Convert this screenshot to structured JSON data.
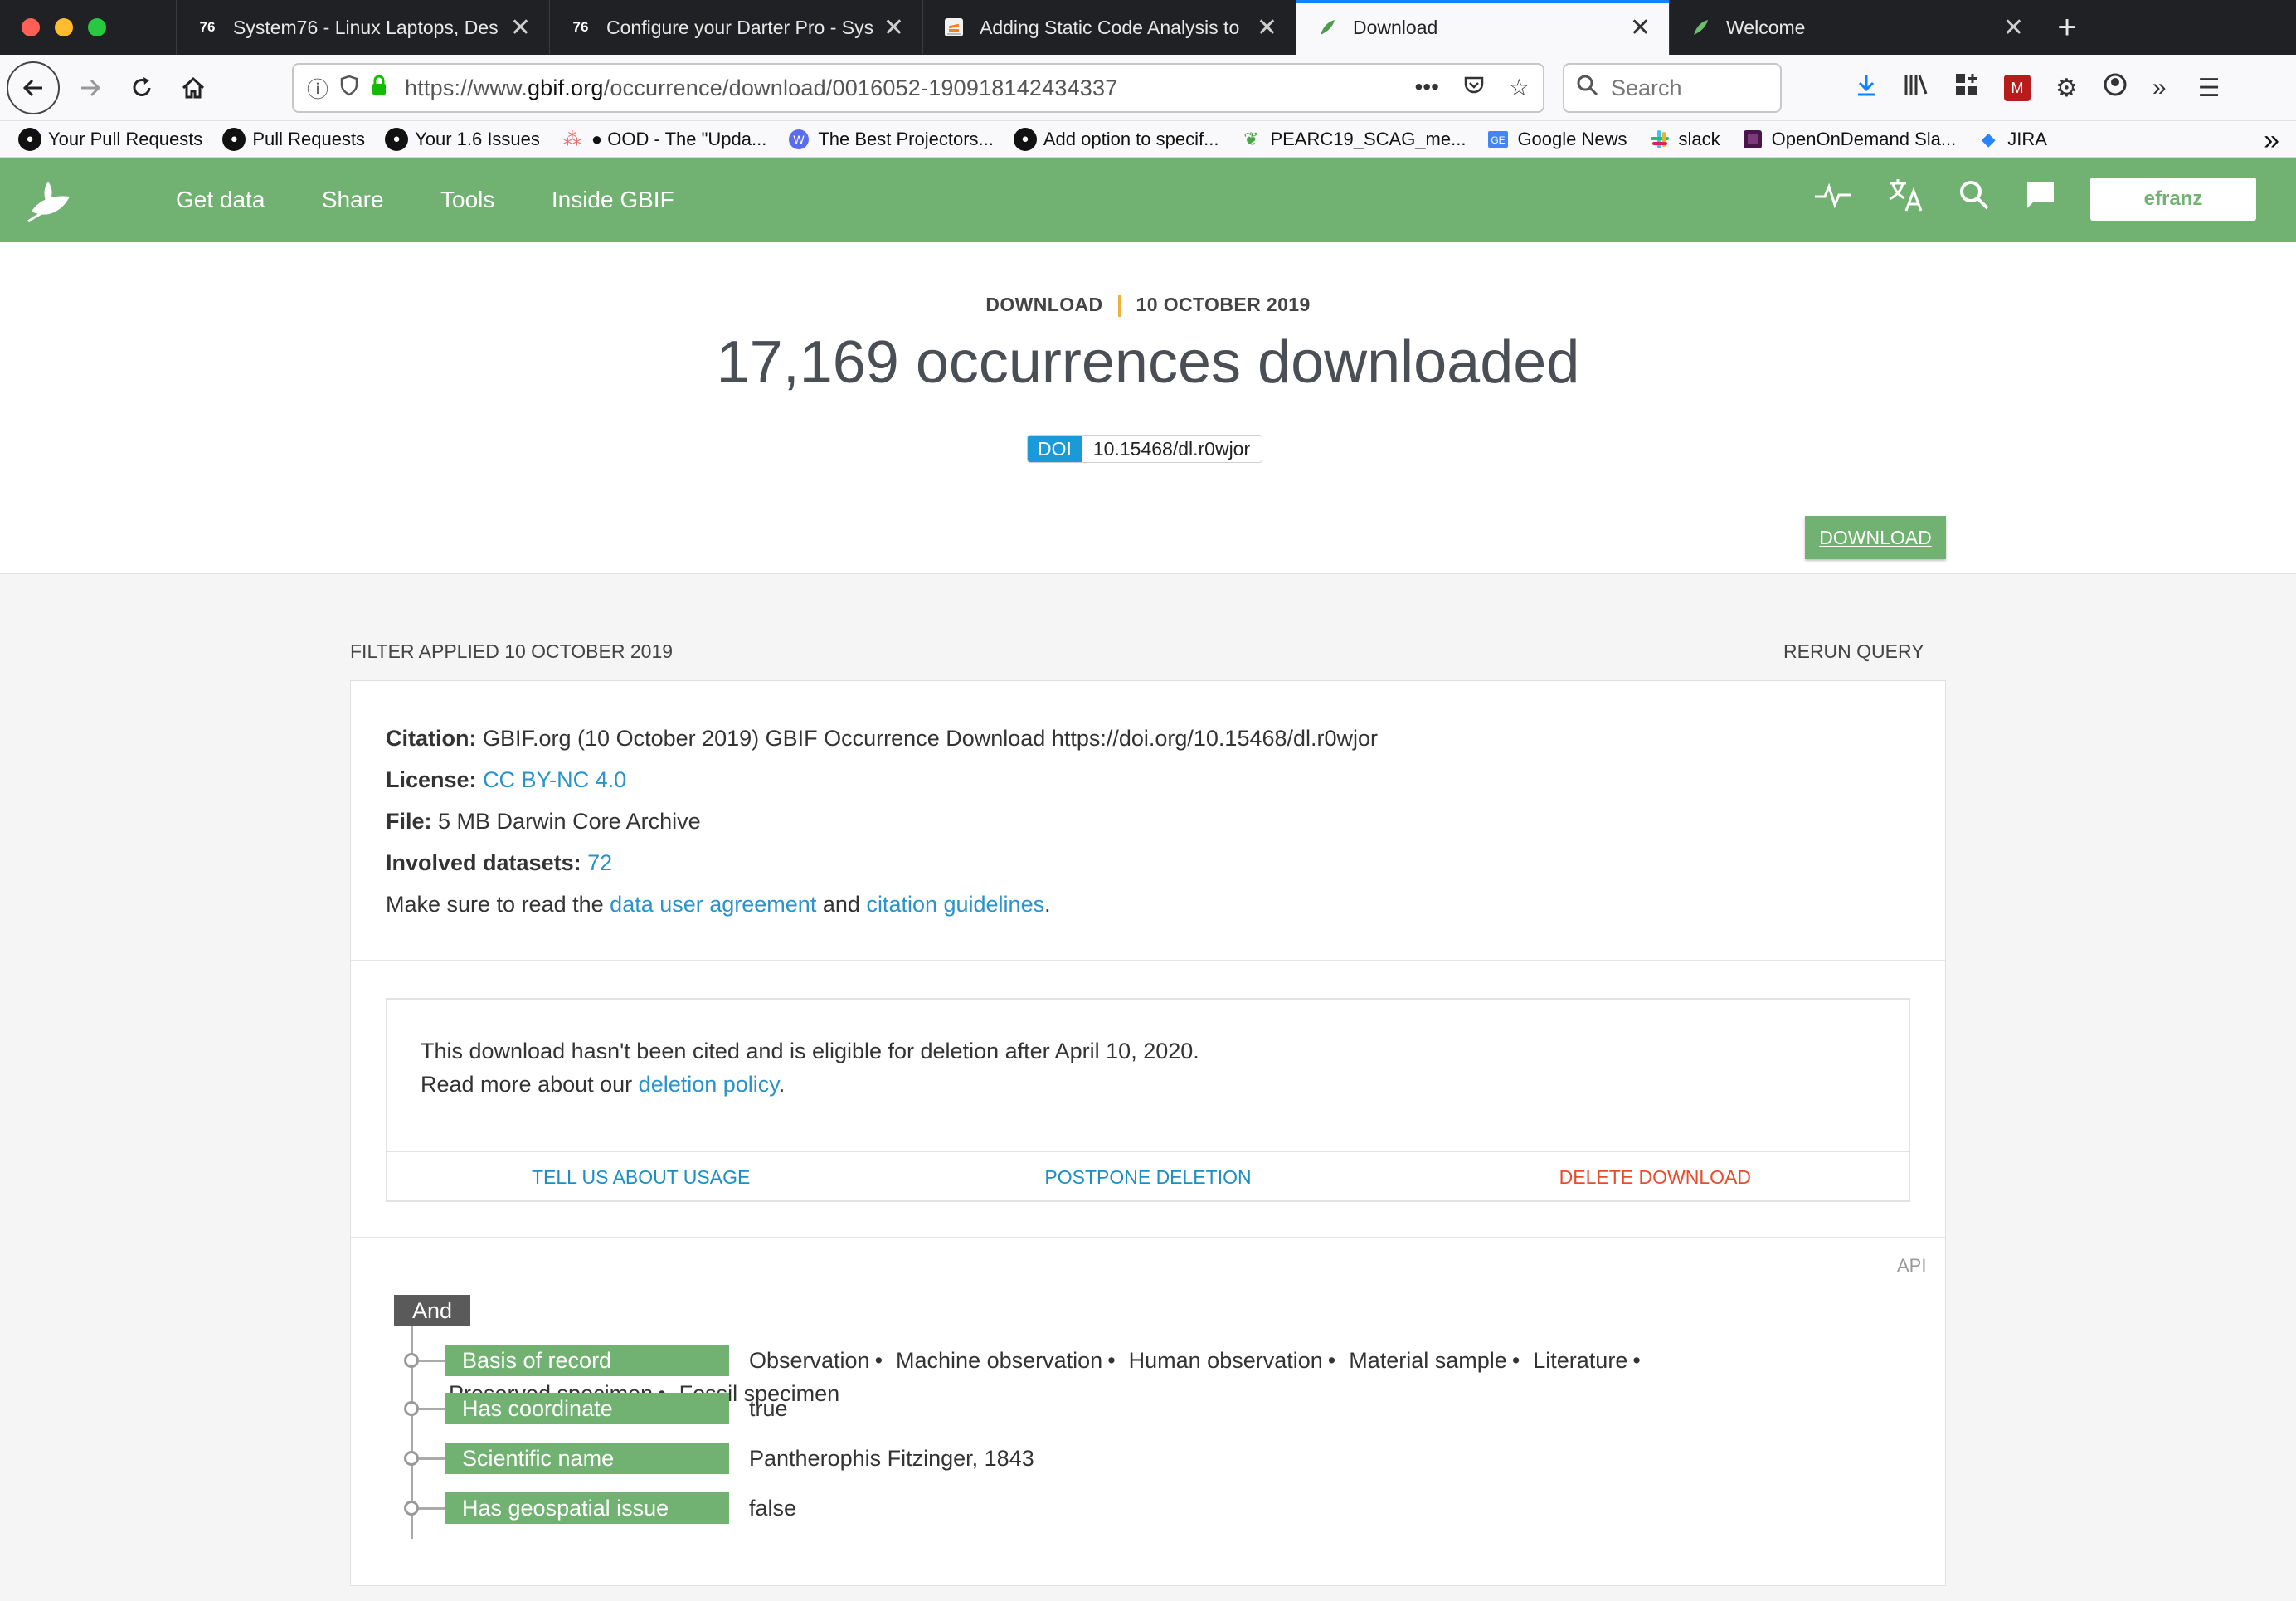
{
  "browser": {
    "tabs": [
      {
        "title": "System76 - Linux Laptops, Des",
        "favicon": "system76-icon",
        "active": false
      },
      {
        "title": "Configure your Darter Pro - Sys",
        "favicon": "system76-icon",
        "active": false
      },
      {
        "title": "Adding Static Code Analysis to",
        "favicon": "stackoverflow-icon",
        "active": false
      },
      {
        "title": "Download",
        "favicon": "gbif-icon",
        "active": true
      },
      {
        "title": "Welcome",
        "favicon": "gbif-icon",
        "active": false
      }
    ],
    "url_prefix": "https://www.",
    "url_domain": "gbif.org",
    "url_path": "/occurrence/download/0016052-190918142434337",
    "search_placeholder": "Search",
    "bookmarks": [
      {
        "label": "Your Pull Requests",
        "icon": "github-icon"
      },
      {
        "label": "Pull Requests",
        "icon": "github-icon"
      },
      {
        "label": "Your 1.6 Issues",
        "icon": "github-icon"
      },
      {
        "label": "● OOD - The \"Upda...",
        "icon": "asana-icon"
      },
      {
        "label": "The Best Projectors...",
        "icon": "wirecutter-icon"
      },
      {
        "label": "Add option to specif...",
        "icon": "github-icon"
      },
      {
        "label": "PEARC19_SCAG_me...",
        "icon": "leaf-icon"
      },
      {
        "label": "Google News",
        "icon": "google-news-icon"
      },
      {
        "label": "slack",
        "icon": "slack-icon"
      },
      {
        "label": "OpenOnDemand Sla...",
        "icon": "slack-workspace-icon"
      },
      {
        "label": "JIRA",
        "icon": "jira-icon"
      }
    ]
  },
  "gbif": {
    "menu": [
      "Get data",
      "Share",
      "Tools",
      "Inside GBIF"
    ],
    "user": "efranz",
    "accent": "#71b171"
  },
  "hero": {
    "kicker": "DOWNLOAD",
    "date": "10 OCTOBER 2019",
    "title": "17,169 occurrences downloaded",
    "doi_label": "DOI",
    "doi_value": "10.15468/dl.r0wjor",
    "download_button": "DOWNLOAD"
  },
  "filter": {
    "heading": "FILTER APPLIED 10 OCTOBER 2019",
    "rerun": "RERUN QUERY",
    "citation_label": "Citation:",
    "citation_text": "GBIF.org (10 October 2019) GBIF Occurrence Download https://doi.org/10.15468/dl.r0wjor",
    "license_label": "License:",
    "license_value": "CC BY-NC 4.0",
    "file_label": "File:",
    "file_value": "5 MB Darwin Core Archive",
    "datasets_label": "Involved datasets:",
    "datasets_value": "72",
    "agreement_pre": "Make sure to read the",
    "agreement_link": "data user agreement",
    "agreement_and": "and",
    "guidelines_link": "citation guidelines",
    "agreement_post": "."
  },
  "notice": {
    "line1": "This download hasn't been cited and is eligible for deletion after April 10, 2020.",
    "line2_pre": "Read more about our",
    "line2_link": "deletion policy",
    "line2_post": ".",
    "actions": {
      "usage": "TELL US ABOUT USAGE",
      "postpone": "POSTPONE DELETION",
      "delete": "DELETE DOWNLOAD"
    }
  },
  "query": {
    "api": "API",
    "operator": "And",
    "rows": [
      {
        "label": "Basis of record",
        "values_line1": [
          "Observation",
          "Machine observation",
          "Human observation",
          "Material sample",
          "Literature"
        ],
        "values_line2": [
          "Preserved specimen",
          "Fossil specimen"
        ]
      },
      {
        "label": "Has coordinate",
        "value": "true"
      },
      {
        "label": "Scientific name",
        "value": "Pantherophis Fitzinger, 1843"
      },
      {
        "label": "Has geospatial issue",
        "value": "false"
      }
    ]
  }
}
